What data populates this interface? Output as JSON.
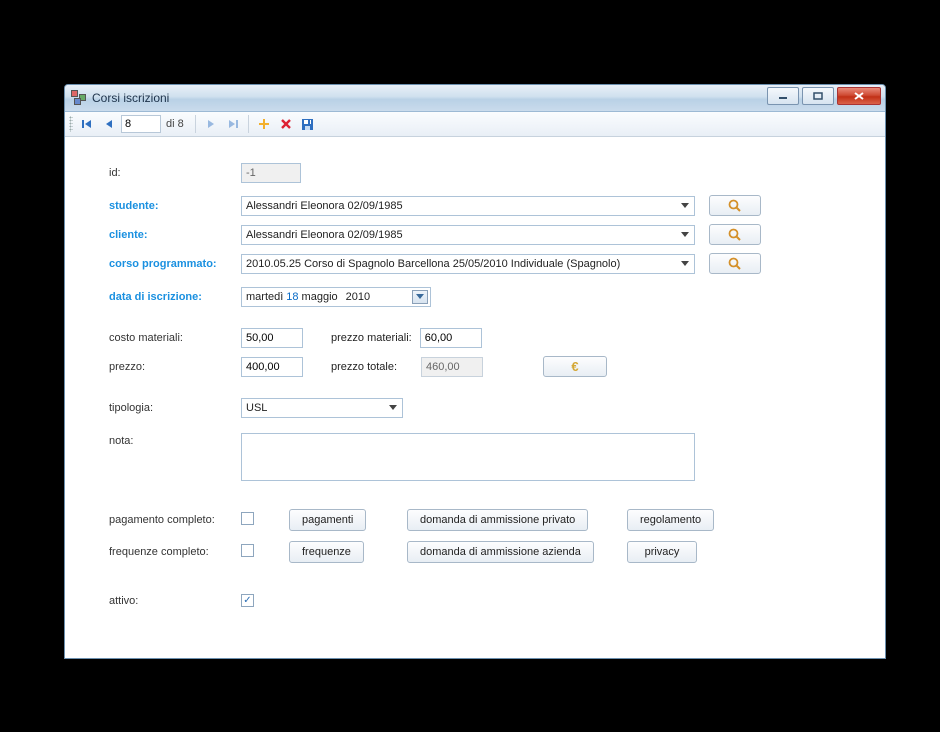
{
  "title": "Corsi iscrizioni",
  "nav": {
    "position": "8",
    "total_prefix": "di",
    "total": "8"
  },
  "form": {
    "id_label": "id:",
    "id_value": "-1",
    "studente_label": "studente:",
    "studente_value": "Alessandri Eleonora 02/09/1985",
    "cliente_label": "cliente:",
    "cliente_value": "Alessandri Eleonora 02/09/1985",
    "corso_label": "corso programmato:",
    "corso_value": "2010.05.25 Corso di Spagnolo Barcellona 25/05/2010 Individuale (Spagnolo)",
    "data_label": "data di iscrizione:",
    "data_weekday": "martedì",
    "data_day": "18",
    "data_month": "maggio",
    "data_year": "2010",
    "costo_materiali_label": "costo materiali:",
    "costo_materiali": "50,00",
    "prezzo_materiali_label": "prezzo materiali:",
    "prezzo_materiali": "60,00",
    "prezzo_label": "prezzo:",
    "prezzo": "400,00",
    "prezzo_totale_label": "prezzo totale:",
    "prezzo_totale": "460,00",
    "euro_symbol": "€",
    "tipologia_label": "tipologia:",
    "tipologia_value": "USL",
    "nota_label": "nota:",
    "nota_value": ""
  },
  "actions": {
    "pagamento_label": "pagamento completo:",
    "pagamenti_btn": "pagamenti",
    "domanda_privato_btn": "domanda di ammissione privato",
    "regolamento_btn": "regolamento",
    "frequenze_label": "frequenze completo:",
    "frequenze_btn": "frequenze",
    "domanda_azienda_btn": "domanda di ammissione azienda",
    "privacy_btn": "privacy",
    "attivo_label": "attivo:"
  },
  "checkboxes": {
    "pagamento_completo": false,
    "frequenze_completo": false,
    "attivo": true
  }
}
